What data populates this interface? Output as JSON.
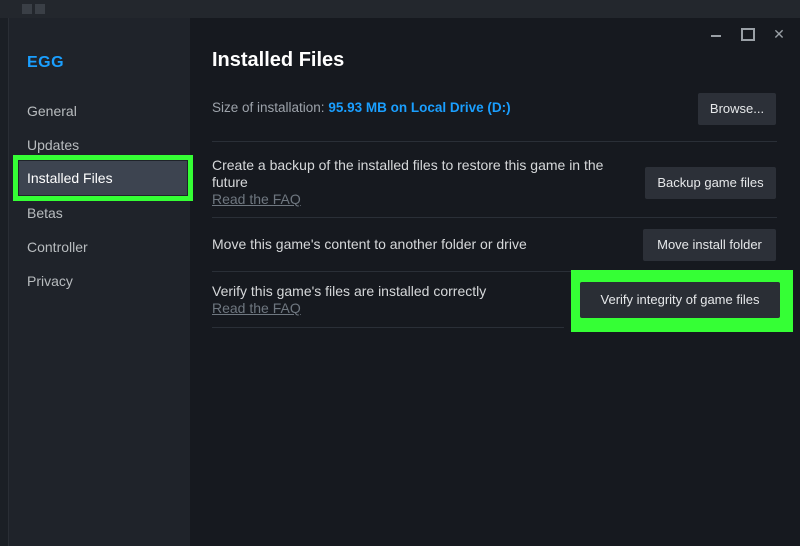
{
  "sidebar": {
    "game_title": "EGG",
    "items": [
      {
        "label": "General"
      },
      {
        "label": "Updates"
      },
      {
        "label": "Installed Files"
      },
      {
        "label": "Betas"
      },
      {
        "label": "Controller"
      },
      {
        "label": "Privacy"
      }
    ],
    "active_index": 2
  },
  "main": {
    "title": "Installed Files",
    "size_label": "Size of installation:",
    "size_value": "95.93 MB on Local Drive (D:)",
    "browse_label": "Browse...",
    "rows": [
      {
        "description": "Create a backup of the installed files to restore this game in the future",
        "link": "Read the FAQ",
        "button": "Backup game files"
      },
      {
        "description": "Move this game's content to another folder or drive",
        "button": "Move install folder"
      },
      {
        "description": "Verify this game's files are installed correctly",
        "link": "Read the FAQ",
        "button": "Verify integrity of game files"
      }
    ]
  },
  "window_controls": {
    "minimize_icon": "minimize-icon",
    "maximize_icon": "maximize-icon",
    "close_icon": "close-icon"
  },
  "colors": {
    "accent": "#1a9fff",
    "highlight": "#35ff35",
    "background": "#16191f",
    "sidebar": "#1f232a",
    "button": "#2c3038"
  }
}
